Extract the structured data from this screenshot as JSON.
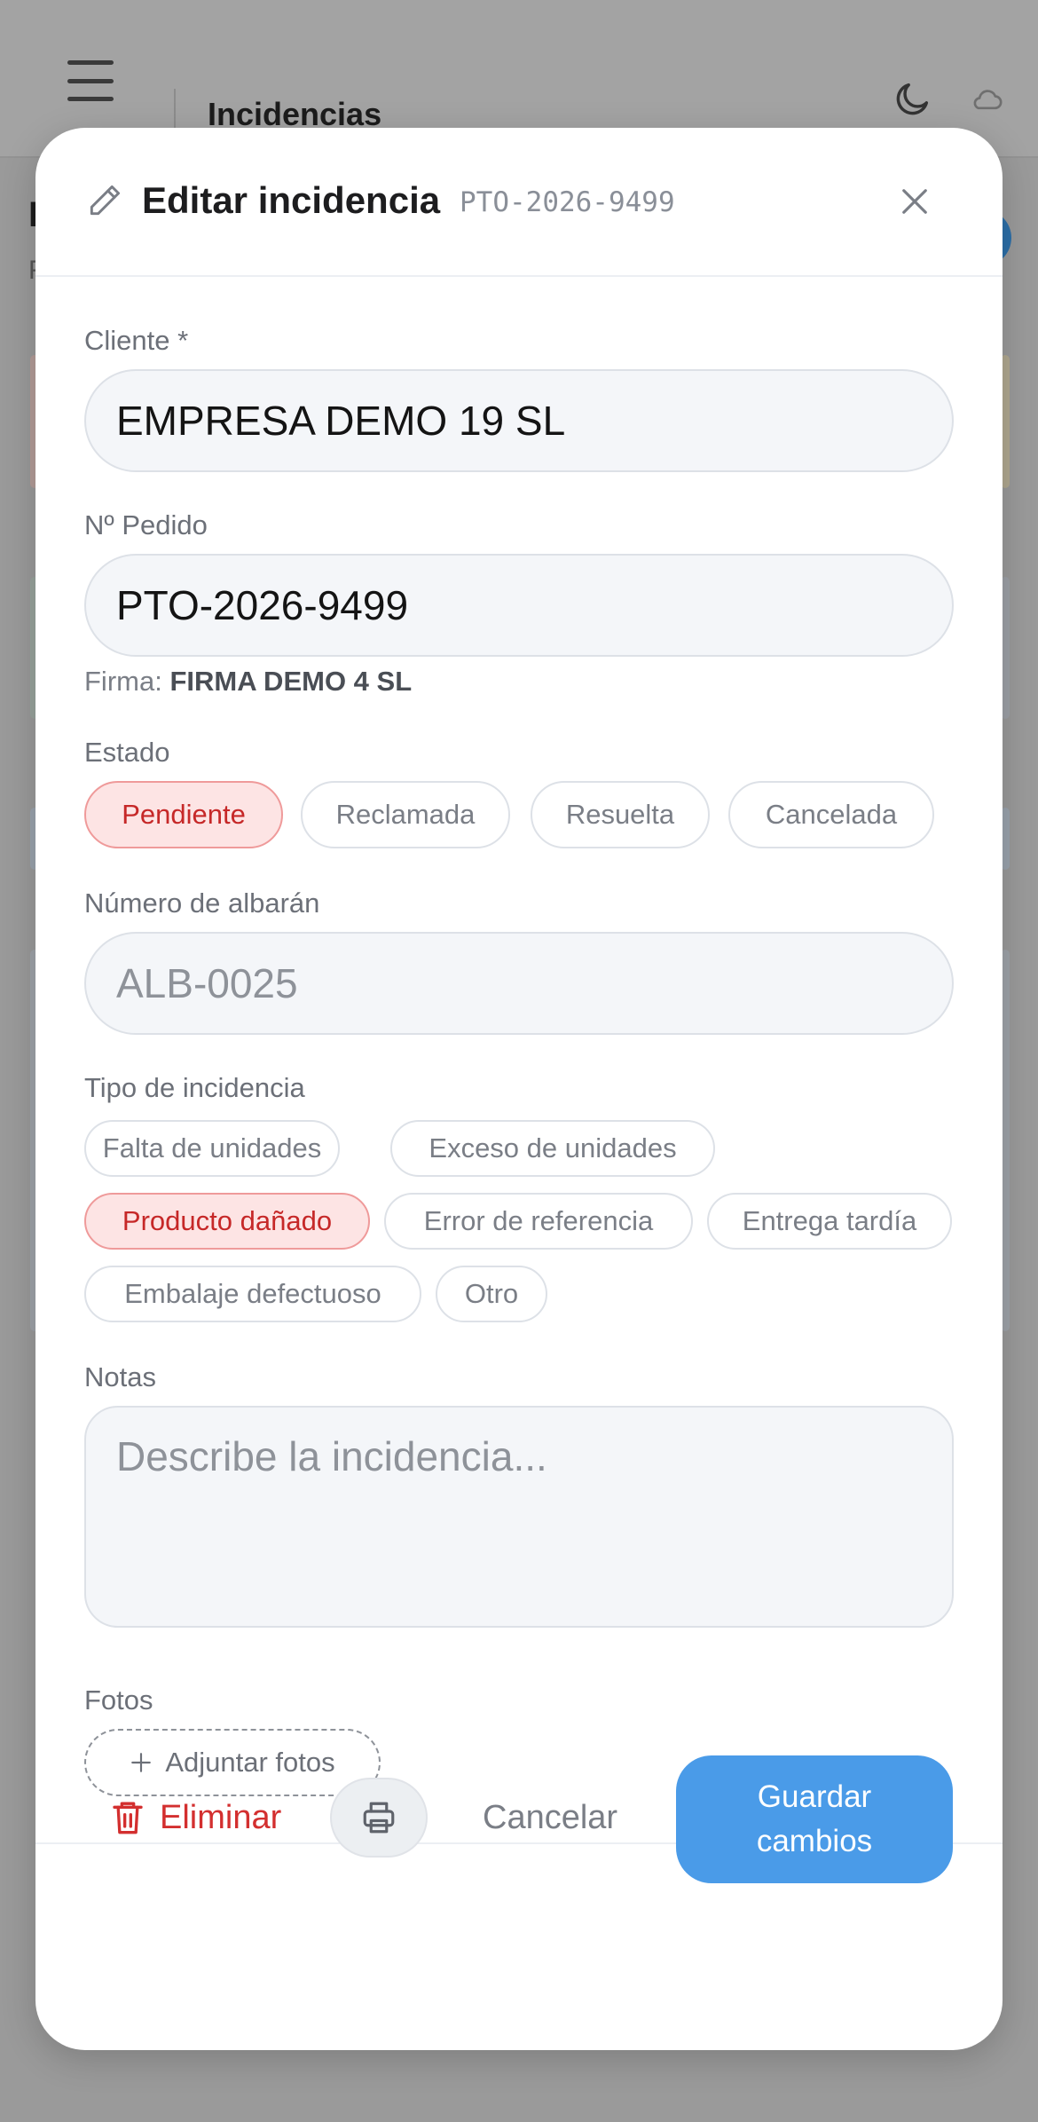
{
  "background": {
    "header_title": "Incidencias"
  },
  "modal": {
    "title": "Editar incidencia",
    "code": "PTO-2026-9499"
  },
  "form": {
    "cliente_label": "Cliente *",
    "cliente_value": "EMPRESA DEMO 19 SL",
    "pedido_label": "Nº Pedido",
    "pedido_value": "PTO-2026-9499",
    "firma_label": "Firma:",
    "firma_value": "FIRMA DEMO 4 SL",
    "estado_label": "Estado",
    "estado_options": [
      "Pendiente",
      "Reclamada",
      "Resuelta",
      "Cancelada"
    ],
    "estado_selected": "Pendiente",
    "albaran_label": "Número de albarán",
    "albaran_placeholder": "ALB-0025",
    "tipo_label": "Tipo de incidencia",
    "tipo_options": [
      "Falta de unidades",
      "Exceso de unidades",
      "Producto dañado",
      "Error de referencia",
      "Entrega tardía",
      "Embalaje defectuoso",
      "Otro"
    ],
    "tipo_selected": "Producto dañado",
    "notas_label": "Notas",
    "notas_placeholder": "Describe la incidencia...",
    "fotos_label": "Fotos",
    "attach_label": "Adjuntar fotos"
  },
  "footer": {
    "delete_label": "Eliminar",
    "cancel_label": "Cancelar",
    "save_label": "Guardar cambios"
  },
  "colors": {
    "accent": "#4a9be8",
    "danger": "#d32f2f",
    "chip_active_bg": "#fde4e4"
  },
  "icons": {
    "menu": "hamburger-icon",
    "theme": "moon-icon",
    "sync": "cloud-icon",
    "edit": "pencil-icon",
    "close": "close-icon",
    "add": "plus-icon",
    "delete": "trash-icon",
    "print": "printer-icon"
  }
}
